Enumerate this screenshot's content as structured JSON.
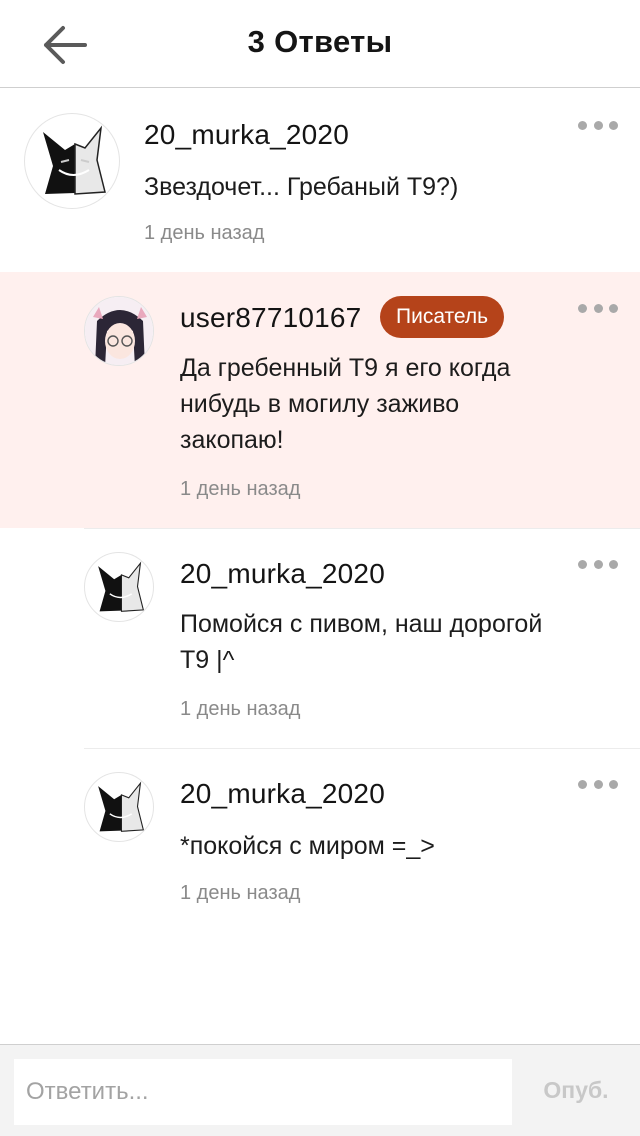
{
  "header": {
    "title": "3 Ответы"
  },
  "root_comment": {
    "username": "20_murka_2020",
    "text": "Звездочет... Гребаный Т9?)",
    "time": "1 день назад"
  },
  "replies": [
    {
      "username": "user87710167",
      "badge": "Писатель",
      "text_lines": [
        "Да гребенный Т9 я его когда",
        "нибудь в могилу заживо",
        "закопаю!"
      ],
      "time": "1 день назад"
    },
    {
      "username": "20_murka_2020",
      "text_lines": [
        "Помойся с пивом, наш дорогой",
        "Т9 |^"
      ],
      "time": "1 день назад"
    },
    {
      "username": "20_murka_2020",
      "text_lines": [
        "*покойся с миром =_>"
      ],
      "time": "1 день назад"
    }
  ],
  "footer": {
    "reply_placeholder": "Ответить...",
    "publish_label": "Опуб."
  },
  "colors": {
    "badge": "#b5431a",
    "highlight_bg": "#fff0ee",
    "muted_text": "#8a8a8a"
  }
}
